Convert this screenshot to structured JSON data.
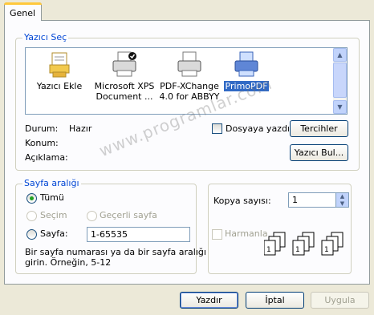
{
  "tab": {
    "label": "Genel"
  },
  "printer_group": {
    "title": "Yazıcı Seç",
    "printers": [
      {
        "name": "Yazıcı Ekle",
        "icon": "add-printer-icon"
      },
      {
        "name": "Microsoft XPS Document ...",
        "icon": "printer-default-icon"
      },
      {
        "name": "PDF-XChange 4.0 for ABBYY",
        "icon": "printer-icon"
      },
      {
        "name": "PrimoPDF",
        "icon": "primopdf-printer-icon",
        "selected": true
      }
    ],
    "status_label": "Durum:",
    "status_value": "Hazır",
    "location_label": "Konum:",
    "comment_label": "Açıklama:",
    "print_to_file_label": "Dosyaya yazdır",
    "preferences_button": "Tercihler",
    "find_printer_button": "Yazıcı Bul..."
  },
  "page_range": {
    "title": "Sayfa aralığı",
    "all_label": "Tümü",
    "selection_label": "Seçim",
    "current_page_label": "Geçerli sayfa",
    "pages_label": "Sayfa:",
    "pages_value": "1-65535",
    "help_line1": "Bir sayfa numarası ya da bir sayfa aralığı",
    "help_line2": "girin.  Örneğin, 5-12"
  },
  "copies": {
    "label": "Kopya sayısı:",
    "value": "1",
    "collate_label": "Harmanla"
  },
  "watermark": "www.programlar.com",
  "buttons": {
    "print": "Yazdır",
    "cancel": "İptal",
    "apply": "Uygula"
  },
  "colors": {
    "selection": "#316ac5",
    "group_title": "#0046d5",
    "background": "#ece9d8"
  }
}
